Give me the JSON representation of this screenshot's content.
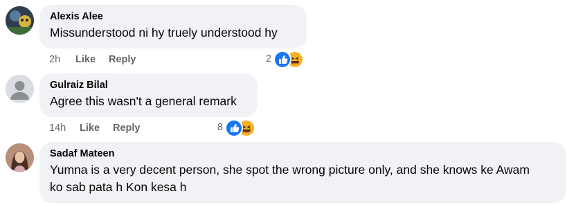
{
  "comments": [
    {
      "author": "Alexis Alee",
      "text": "Missunderstood ni hy truely understood hy",
      "time": "2h",
      "like_label": "Like",
      "reply_label": "Reply",
      "reaction_count": "2",
      "reactions": [
        "like-icon",
        "haha-icon"
      ]
    },
    {
      "author": "Gulraiz Bilal",
      "text": "Agree this wasn't a general remark",
      "time": "14h",
      "like_label": "Like",
      "reply_label": "Reply",
      "reaction_count": "8",
      "reactions": [
        "like-icon",
        "haha-icon"
      ]
    },
    {
      "author": "Sadaf Mateen",
      "text": "Yumna is a very decent person, she spot the wrong picture only, and she knows ke Awam ko sab pata h Kon kesa h"
    }
  ],
  "colors": {
    "bubble_bg": "#f0f2f5",
    "meta_text": "#65676b",
    "like_blue": "#1877f2",
    "haha_yellow": "#f7b125"
  }
}
